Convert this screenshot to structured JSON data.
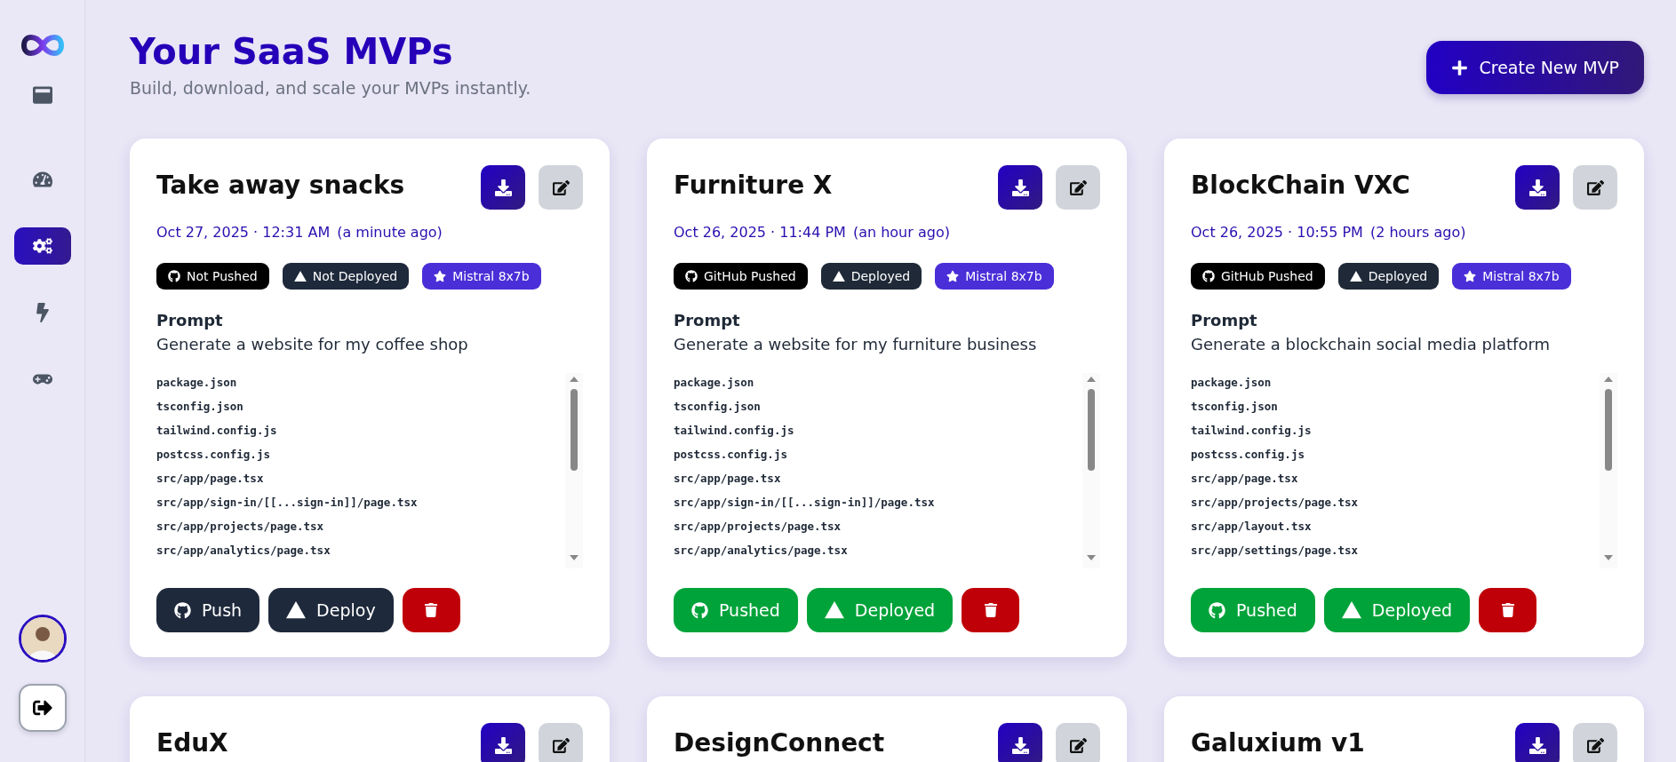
{
  "sidebar": {
    "nav": [
      {
        "kind": "window",
        "selected": false
      },
      {
        "kind": "gauge",
        "selected": false
      },
      {
        "kind": "gears",
        "selected": true
      },
      {
        "kind": "bolt",
        "selected": false
      },
      {
        "kind": "gamepad",
        "selected": false
      }
    ]
  },
  "header": {
    "title": "Your SaaS MVPs",
    "subtitle": "Build, download, and scale your MVPs instantly.",
    "create_button": "Create New MVP"
  },
  "projects": [
    {
      "name": "Take away snacks",
      "date": "Oct 27, 2025 · 12:31 AM",
      "ago": "(a minute ago)",
      "pushed": false,
      "deployed": false,
      "push_badge": "Not Pushed",
      "deploy_badge": "Not Deployed",
      "model": "Mistral 8x7b",
      "prompt_label": "Prompt",
      "prompt": "Generate a website for my coffee shop",
      "files": [
        "package.json",
        "tsconfig.json",
        "tailwind.config.js",
        "postcss.config.js",
        "src/app/page.tsx",
        "src/app/sign-in/[[...sign-in]]/page.tsx",
        "src/app/projects/page.tsx",
        "src/app/analytics/page.tsx"
      ],
      "push_button": "Push",
      "deploy_button": "Deploy"
    },
    {
      "name": "Furniture X",
      "date": "Oct 26, 2025 · 11:44 PM",
      "ago": "(an hour ago)",
      "pushed": true,
      "deployed": true,
      "push_badge": "GitHub Pushed",
      "deploy_badge": "Deployed",
      "model": "Mistral 8x7b",
      "prompt_label": "Prompt",
      "prompt": "Generate a website for my furniture business",
      "files": [
        "package.json",
        "tsconfig.json",
        "tailwind.config.js",
        "postcss.config.js",
        "src/app/page.tsx",
        "src/app/sign-in/[[...sign-in]]/page.tsx",
        "src/app/projects/page.tsx",
        "src/app/analytics/page.tsx"
      ],
      "push_button": "Pushed",
      "deploy_button": "Deployed"
    },
    {
      "name": "BlockChain VXC",
      "date": "Oct 26, 2025 · 10:55 PM",
      "ago": "(2 hours ago)",
      "pushed": true,
      "deployed": true,
      "push_badge": "GitHub Pushed",
      "deploy_badge": "Deployed",
      "model": "Mistral 8x7b",
      "prompt_label": "Prompt",
      "prompt": "Generate a blockchain social media platform",
      "files": [
        "package.json",
        "tsconfig.json",
        "tailwind.config.js",
        "postcss.config.js",
        "src/app/page.tsx",
        "src/app/projects/page.tsx",
        "src/app/layout.tsx",
        "src/app/settings/page.tsx"
      ],
      "push_button": "Pushed",
      "deploy_button": "Deployed"
    },
    {
      "name": "EduX"
    },
    {
      "name": "DesignConnect"
    },
    {
      "name": "Galuxium v1"
    }
  ]
}
